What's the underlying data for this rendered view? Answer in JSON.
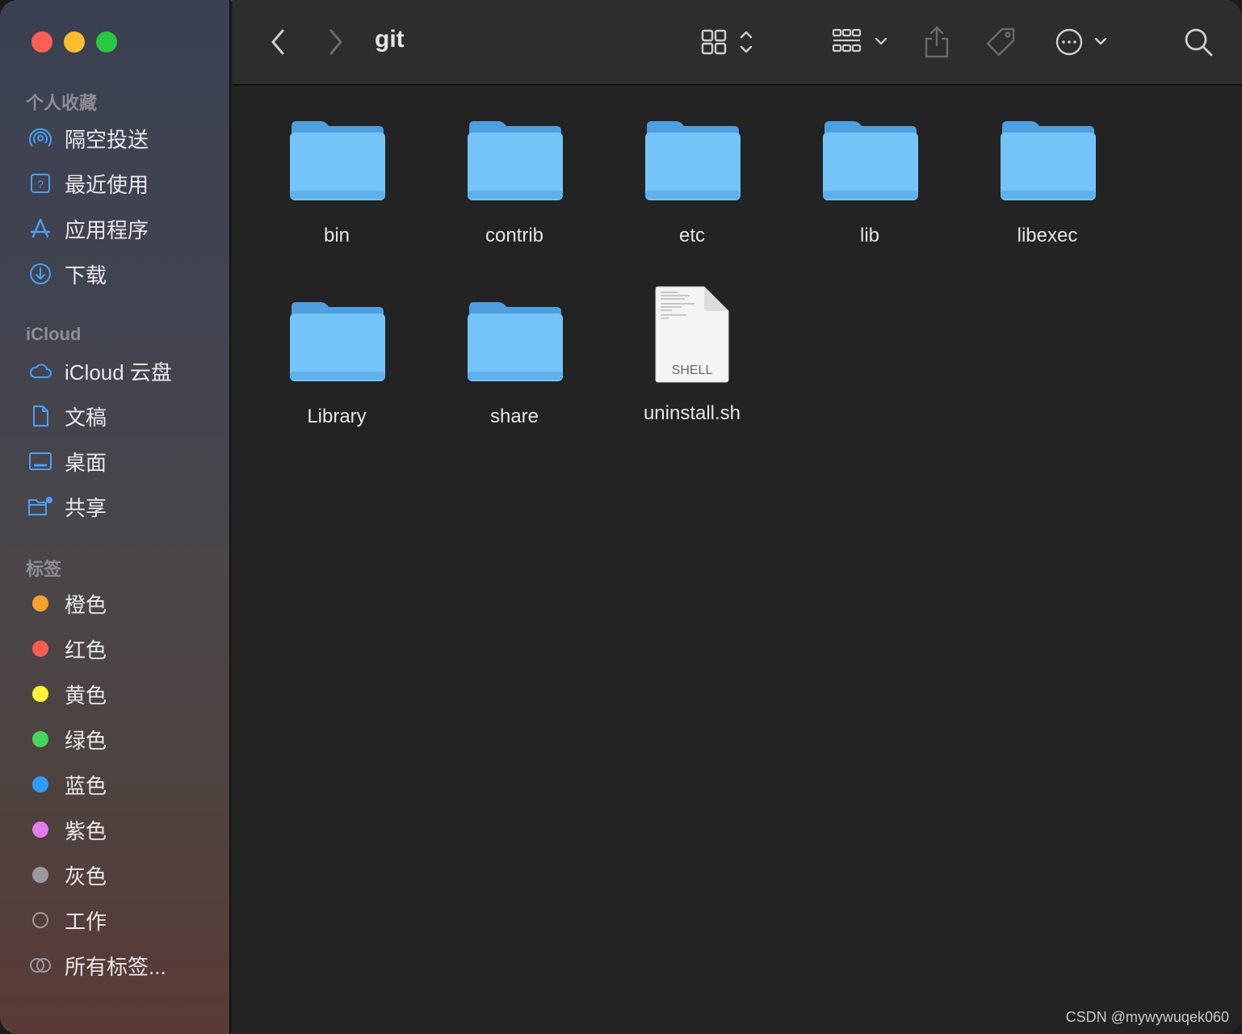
{
  "window": {
    "title": "git"
  },
  "sidebar": {
    "favorites_title": "个人收藏",
    "favorites": [
      {
        "label": "隔空投送",
        "icon": "airdrop-icon"
      },
      {
        "label": "最近使用",
        "icon": "recents-icon"
      },
      {
        "label": "应用程序",
        "icon": "applications-icon"
      },
      {
        "label": "下载",
        "icon": "downloads-icon"
      }
    ],
    "icloud_title": "iCloud",
    "icloud": [
      {
        "label": "iCloud 云盘",
        "icon": "cloud-icon"
      },
      {
        "label": "文稿",
        "icon": "document-icon"
      },
      {
        "label": "桌面",
        "icon": "desktop-icon"
      },
      {
        "label": "共享",
        "icon": "shared-folder-icon"
      }
    ],
    "tags_title": "标签",
    "tags": [
      {
        "label": "橙色",
        "color": "#f7a12e"
      },
      {
        "label": "红色",
        "color": "#f75c53"
      },
      {
        "label": "黄色",
        "color": "#fff23a"
      },
      {
        "label": "绿色",
        "color": "#45d65d"
      },
      {
        "label": "蓝色",
        "color": "#2f9bf9"
      },
      {
        "label": "紫色",
        "color": "#e27cf0"
      },
      {
        "label": "灰色",
        "color": "#9a9a9e"
      },
      {
        "label": "工作",
        "color": "none"
      },
      {
        "label": "所有标签...",
        "color": "all"
      }
    ]
  },
  "content": {
    "items": [
      {
        "name": "bin",
        "kind": "folder"
      },
      {
        "name": "contrib",
        "kind": "folder"
      },
      {
        "name": "etc",
        "kind": "folder"
      },
      {
        "name": "lib",
        "kind": "folder"
      },
      {
        "name": "libexec",
        "kind": "folder"
      },
      {
        "name": "Library",
        "kind": "folder"
      },
      {
        "name": "share",
        "kind": "folder"
      },
      {
        "name": "uninstall.sh",
        "kind": "file",
        "badge": "SHELL"
      }
    ]
  },
  "watermark": "CSDN @mywywuqek060",
  "colors": {
    "folder": "#6ec1f5",
    "accent": "#5ba3f3"
  }
}
